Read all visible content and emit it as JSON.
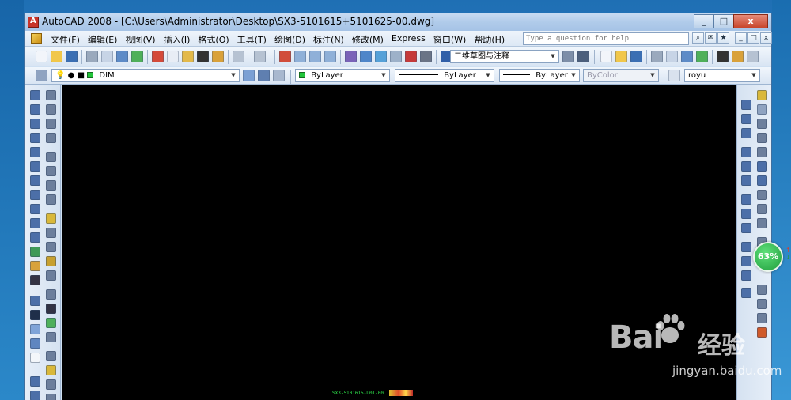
{
  "window": {
    "title": "AutoCAD 2008 - [C:\\Users\\Administrator\\Desktop\\SX3-5101615+5101625-00.dwg]",
    "controls": [
      "_",
      "□",
      "x"
    ]
  },
  "menu": {
    "items": [
      "文件(F)",
      "编辑(E)",
      "视图(V)",
      "插入(I)",
      "格式(O)",
      "工具(T)",
      "绘图(D)",
      "标注(N)",
      "修改(M)",
      "Express",
      "窗口(W)",
      "帮助(H)"
    ],
    "help_placeholder": "Type a question for help",
    "doc_controls": [
      "_",
      "□",
      "x"
    ]
  },
  "toolbar": {
    "workspace": "二维草图与注释",
    "layer": "DIM",
    "color": "ByLayer",
    "linetype": "ByLayer",
    "lineweight": "ByLayer",
    "plotstyle": "ByColor",
    "textstyle": "royu"
  },
  "drawing": {
    "title_block_label": "SX3-5101615-U01-00"
  },
  "zoom": {
    "value": "63%",
    "up": "↑",
    "down": "↓"
  },
  "watermark": {
    "logo": "Bai",
    "logo_suffix": "经验",
    "url": "jingyan.baidu.com"
  },
  "colors": {
    "layer_swatch": "#22c53a",
    "canvas": "#000000",
    "zoom_badge": "#1f9d3c"
  }
}
